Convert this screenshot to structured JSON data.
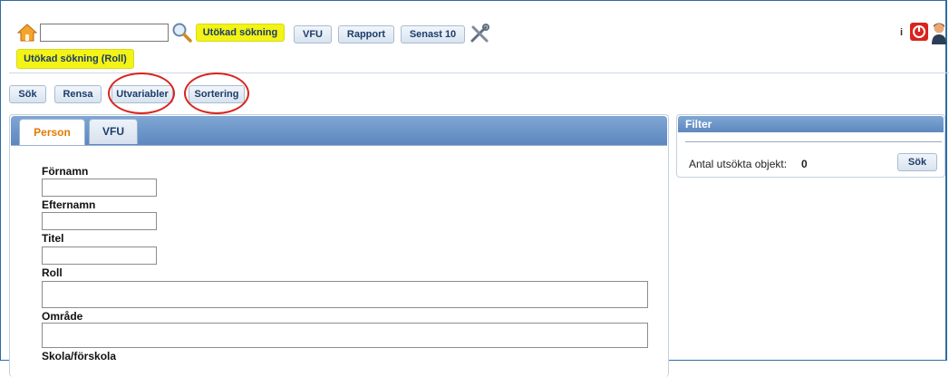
{
  "toolbar": {
    "search_value": "",
    "buttons": {
      "extended": "Utökad sökning",
      "vfu": "VFU",
      "report": "Rapport",
      "latest": "Senast 10"
    },
    "info": "i"
  },
  "subtab": {
    "label": "Utökad sökning (Roll)"
  },
  "actions": {
    "search": "Sök",
    "clear": "Rensa",
    "outvars": "Utvariabler",
    "sort": "Sortering"
  },
  "form": {
    "tabs": [
      "Person",
      "VFU"
    ],
    "active_tab": "Person",
    "fields": [
      {
        "label": "Förnamn",
        "value": ""
      },
      {
        "label": "Efternamn",
        "value": ""
      },
      {
        "label": "Titel",
        "value": ""
      },
      {
        "label": "Roll",
        "value": ""
      },
      {
        "label": "Område",
        "value": ""
      },
      {
        "label": "Skola/förskola",
        "value": ""
      }
    ]
  },
  "filter": {
    "title": "Filter",
    "count_label": "Antal utsökta objekt:",
    "count_value": "0",
    "search_button": "Sök"
  },
  "colors": {
    "highlight": "#f3f315",
    "accent": "#5d88bf",
    "annotation": "#d9241e",
    "active_tab_text": "#e07b00"
  },
  "icons": [
    "home-icon",
    "search-icon",
    "tools-icon",
    "info-icon",
    "power-icon",
    "user-icon"
  ]
}
